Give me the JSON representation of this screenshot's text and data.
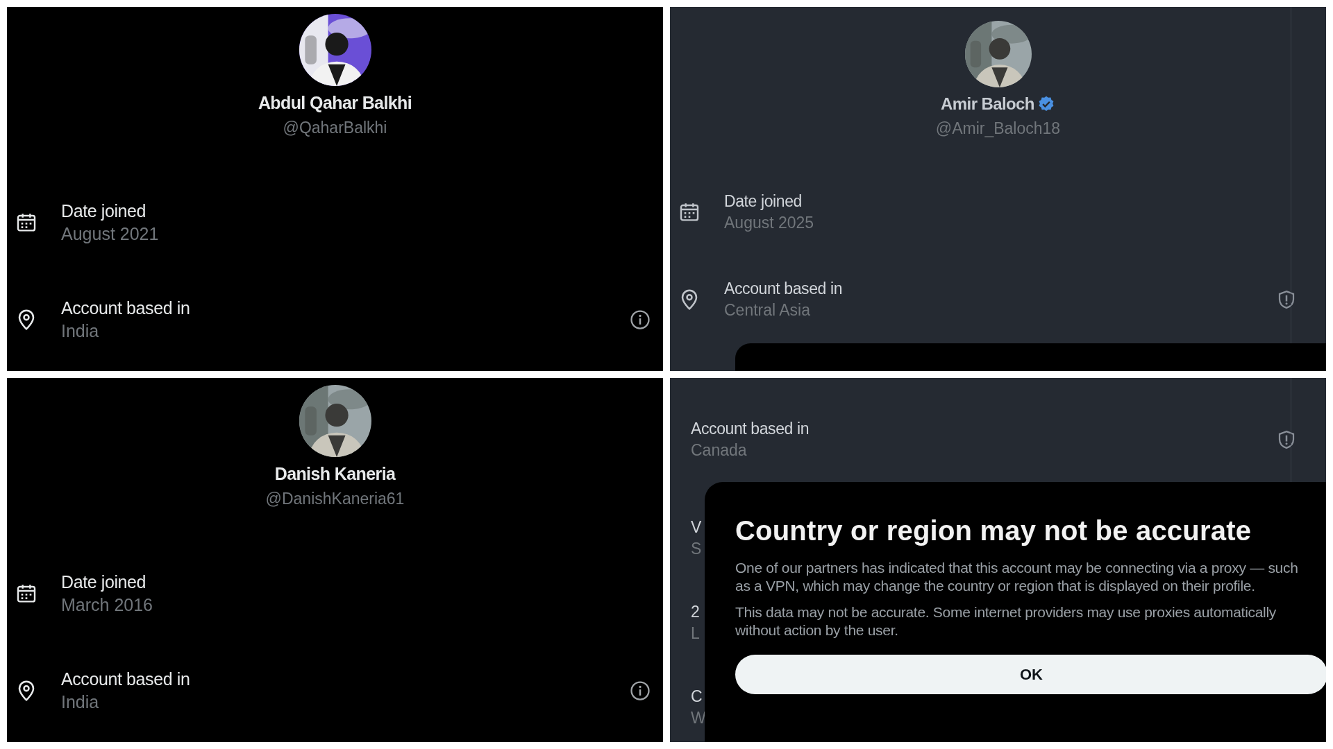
{
  "panels": [
    {
      "kind": "black",
      "profile": {
        "name": "Abdul Qahar Balkhi",
        "handle": "@QaharBalkhi",
        "verified": false
      },
      "rows": [
        {
          "kind": "date",
          "label": "Date joined",
          "value": "August 2021"
        },
        {
          "kind": "location",
          "label": "Account based in",
          "value": "India",
          "action": {
            "kind": "info"
          }
        }
      ]
    },
    {
      "kind": "dim",
      "profile": {
        "name": "Amir Baloch",
        "handle": "@Amir_Baloch18",
        "verified": true
      },
      "rows": [
        {
          "kind": "date",
          "label": "Date joined",
          "value": "August 2025"
        },
        {
          "kind": "location",
          "label": "Account based in",
          "value": "Central Asia",
          "action": {
            "kind": "shield"
          }
        }
      ],
      "dialog_peek": true
    },
    {
      "kind": "black",
      "profile": {
        "name": "Danish Kaneria",
        "handle": "@DanishKaneria61",
        "verified": false
      },
      "rows": [
        {
          "kind": "date",
          "label": "Date joined",
          "value": "March 2016"
        },
        {
          "kind": "location",
          "label": "Account based in",
          "value": "India",
          "action": {
            "kind": "info"
          }
        }
      ]
    },
    {
      "kind": "dim",
      "rows": [
        {
          "kind": "plain",
          "label": "Account based in",
          "value": "Canada",
          "action": {
            "kind": "shield"
          }
        }
      ],
      "hidden_rows": [
        {
          "label": "V",
          "value": "S"
        },
        {
          "label": "2",
          "value": "L"
        },
        {
          "label": "C",
          "value": "W"
        }
      ],
      "dialog": {
        "title": "Country or region may not be accurate",
        "paragraphs": [
          "One of our partners has indicated that this account may be connecting via a proxy — such as a VPN, which may change the country or region that is displayed on their profile.",
          "This data may not be accurate. Some internet providers may use proxies automatically without action by the user."
        ],
        "button": "OK"
      }
    }
  ]
}
